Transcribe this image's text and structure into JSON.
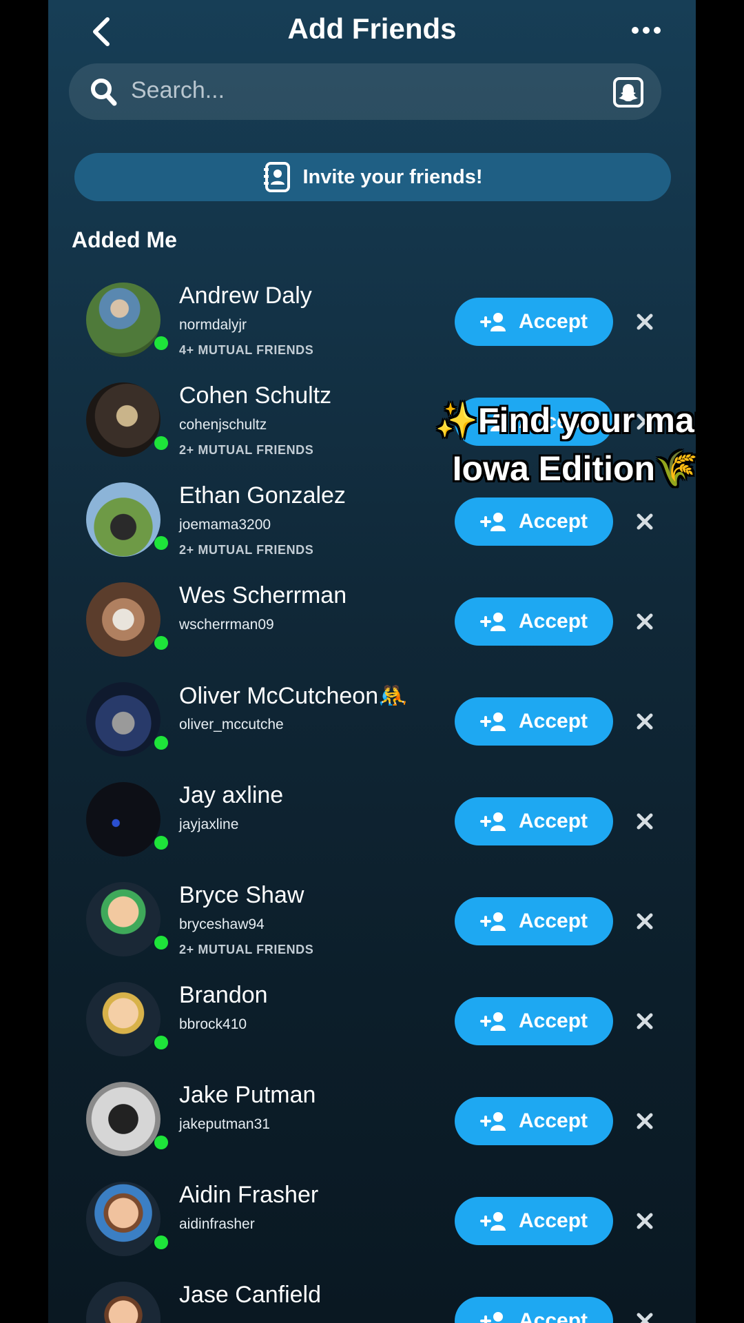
{
  "header": {
    "title": "Add Friends"
  },
  "search": {
    "placeholder": "Search..."
  },
  "invite": {
    "label": "Invite your friends!"
  },
  "section_title": "Added Me",
  "accept_label": "Accept",
  "icons": {
    "back": "chevron-left-icon",
    "more": "more-dots-icon",
    "search": "search-icon",
    "snapcode": "snapcode-icon",
    "invite": "contacts-book-icon",
    "accept": "add-friend-icon",
    "dismiss": "close-icon"
  },
  "colors": {
    "accent": "#1ea8f2",
    "online": "#1ee43a",
    "invite_bg": "#1f5f84"
  },
  "requests": [
    {
      "name": "Andrew Daly",
      "username": "normdalyjr",
      "mutual": "4+ MUTUAL FRIENDS"
    },
    {
      "name": "Cohen Schultz",
      "username": "cohenjschultz",
      "mutual": "2+ MUTUAL FRIENDS"
    },
    {
      "name": "Ethan Gonzalez",
      "username": "joemama3200",
      "mutual": "2+ MUTUAL FRIENDS"
    },
    {
      "name": "Wes Scherrman",
      "username": "wscherrman09",
      "mutual": ""
    },
    {
      "name": "Oliver McCutcheon🤼",
      "username": "oliver_mccutche",
      "mutual": ""
    },
    {
      "name": "Jay axline",
      "username": "jayjaxline",
      "mutual": ""
    },
    {
      "name": "Bryce Shaw",
      "username": "bryceshaw94",
      "mutual": "2+ MUTUAL FRIENDS"
    },
    {
      "name": "Brandon",
      "username": "bbrock410",
      "mutual": ""
    },
    {
      "name": "Jake Putman",
      "username": "jakeputman31",
      "mutual": ""
    },
    {
      "name": "Aidin Frasher",
      "username": "aidinfrasher",
      "mutual": ""
    },
    {
      "name": "Jase Canfield",
      "username": "",
      "mutual": ""
    }
  ],
  "overlay_caption": {
    "line1": "✨Find your man",
    "line2": "Iowa Edition🌾"
  }
}
